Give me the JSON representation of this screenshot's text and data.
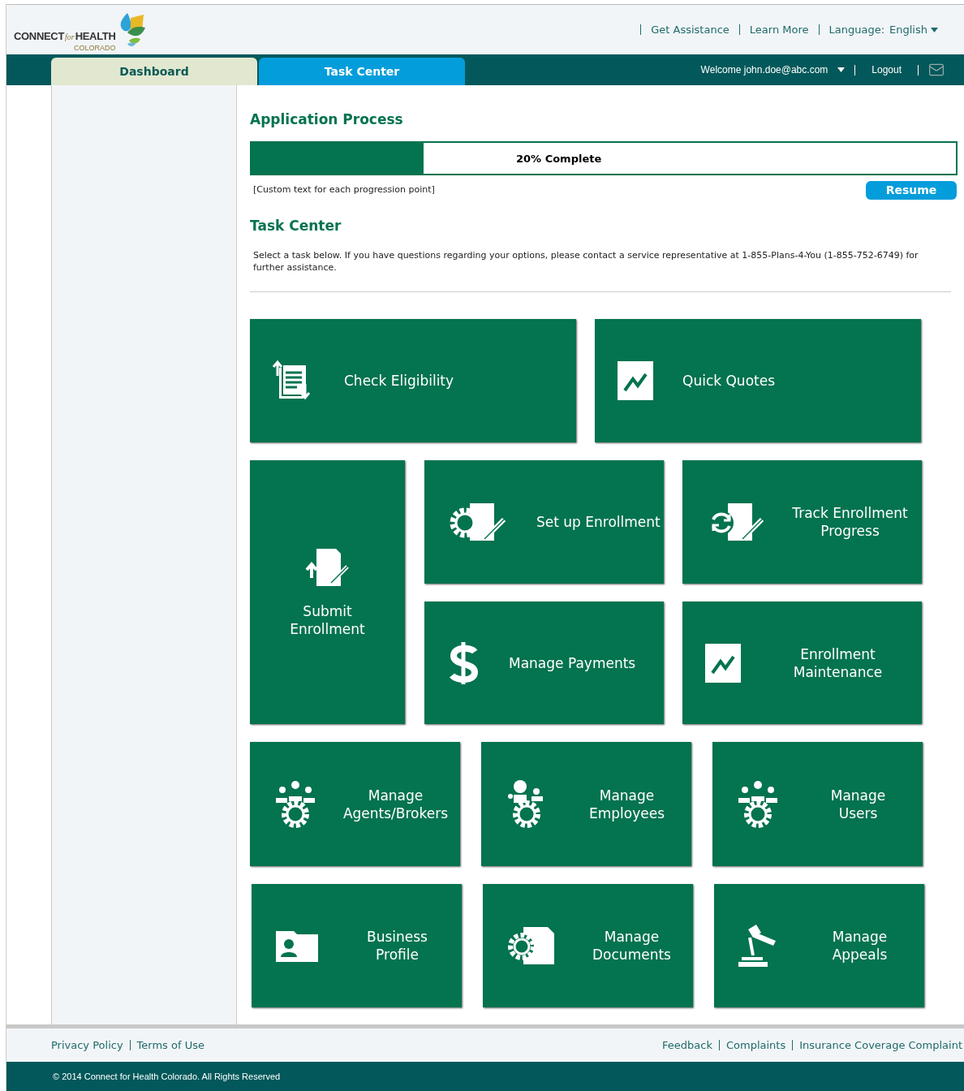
{
  "logo": {
    "word_1": "CONNECT",
    "word_2": "for",
    "word_3": "HEALTH",
    "word_4": "COLORADO"
  },
  "top_links": [
    {
      "label": "Get Assistance",
      "kind": "link"
    },
    {
      "label": "Learn More",
      "kind": "link"
    },
    {
      "label": "Language:",
      "value": "English",
      "kind": "dropdown"
    }
  ],
  "tabs": [
    {
      "label": "Dashboard",
      "selected": false
    },
    {
      "label": "Task Center",
      "selected": true
    }
  ],
  "user_menu": {
    "welcome": "Welcome john.doe@abc.com",
    "logout": "Logout"
  },
  "application_process": {
    "title": "Application Process",
    "progress": {
      "level": 0.244,
      "label": "20% Complete"
    },
    "note": "[Custom text for each progression point]",
    "resume_button": "Resume"
  },
  "task_center": {
    "title": "Task Center",
    "intro": "Select a task below.  If you have questions regarding your options, please contact a service representative at 1-855-Plans-4-You (1-855-752-6749) for further assistance.",
    "tiles": [
      {
        "label": "Check Eligibility",
        "kind": "documents"
      },
      {
        "label": "Quick Quotes",
        "kind": "chart"
      },
      {
        "label": "Submit\nEnrollment",
        "kind": "upload-edit"
      },
      {
        "label": "Set up Enrollment",
        "kind": "gear-edit"
      },
      {
        "label": "Track Enrollment\nProgress",
        "kind": "sync-edit"
      },
      {
        "label": "Manage Payments",
        "kind": "dollar"
      },
      {
        "label": "Enrollment\nMaintenance",
        "kind": "chart"
      },
      {
        "label": "Manage\nAgents/Brokers",
        "kind": "people-gear"
      },
      {
        "label": "Manage\nEmployees",
        "kind": "person-gear"
      },
      {
        "label": "Manage\nUsers",
        "kind": "people-gear"
      },
      {
        "label": "Business\nProfile",
        "kind": "profile"
      },
      {
        "label": "Manage\nDocuments",
        "kind": "gear-doc"
      },
      {
        "label": "Manage\nAppeals",
        "kind": "gavel"
      }
    ]
  },
  "footer": {
    "left_links": [
      "Privacy Policy",
      "Terms of Use"
    ],
    "right_links": [
      "Feedback",
      "Complaints",
      "Insurance Coverage Complaint"
    ],
    "copyright": "© 2014 Connect for Health Colorado.  All Rights Reserved"
  }
}
